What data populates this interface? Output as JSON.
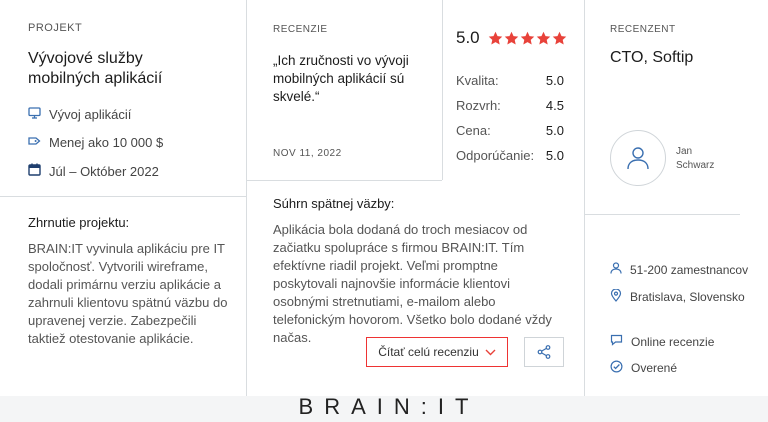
{
  "project": {
    "section_label": "PROJEKT",
    "title": "Vývojové služby mobilných aplikácií",
    "category": "Vývoj aplikácií",
    "budget": "Menej ako 10 000 $",
    "dates": "Júl – Október 2022",
    "summary_title": "Zhrnutie projektu:",
    "summary_text": "BRAIN:IT vyvinula aplikáciu pre IT spoločnosť. Vytvorili wireframe, dodali primárnu verziu aplikácie a zahrnuli klientovu spätnú väzbu do upravenej verzie. Zabezpečili taktiež otestovanie aplikácie."
  },
  "review": {
    "section_label": "RECENZIE",
    "quote": "„Ich zručnosti vo vývoji mobilných aplikácií sú skvelé.“",
    "date": "NOV 11, 2022",
    "overall": "5.0",
    "stars": 5,
    "ratings": [
      {
        "label": "Kvalita:",
        "value": "5.0"
      },
      {
        "label": "Rozvrh:",
        "value": "4.5"
      },
      {
        "label": "Cena:",
        "value": "5.0"
      },
      {
        "label": "Odporúčanie:",
        "value": "5.0"
      }
    ],
    "feedback_title": "Súhrn spätnej väzby:",
    "feedback_text": "Aplikácia bola dodaná do troch mesiacov od začiatku spolupráce s firmou BRAIN:IT. Tím efektívne riadil projekt. Veľmi promptne poskytovali najnovšie informácie klientovi osobnými stretnutiami, e-mailom alebo telefonickým hovorom. Všetko bolo dodané vždy načas.",
    "read_button": "Čítať celú recenziu",
    "accent_color": "#e8423a"
  },
  "reviewer": {
    "section_label": "RECENZENT",
    "role": "CTO, Softip",
    "name": "Jan Schwarz",
    "employees": "51-200 zamestnancov",
    "location": "Bratislava, Slovensko",
    "review_type": "Online recenzie",
    "verified": "Overené"
  },
  "footer": {
    "logo": "BRAIN:IT"
  }
}
